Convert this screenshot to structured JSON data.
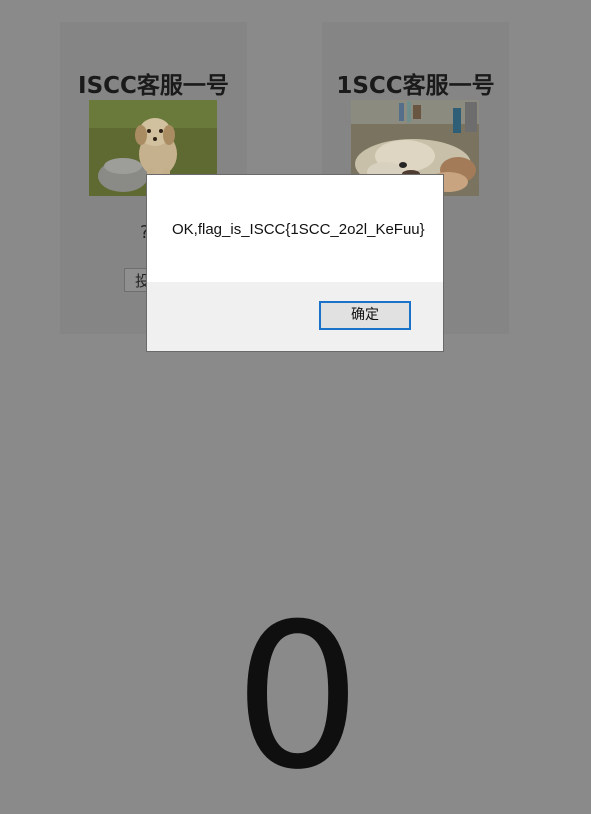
{
  "cards": [
    {
      "title": "ISCC客服一号",
      "photo_icon": "golden-retriever-puppy-photo",
      "sub_text": "?",
      "button_label": "投"
    },
    {
      "title": "1SCC客服一号",
      "photo_icon": "sleeping-dog-photo"
    }
  ],
  "counter": {
    "value": "0"
  },
  "dialog": {
    "message": "OK,flag_is_ISCC{1SCC_2o2l_KeFuu}",
    "ok_label": "确定"
  }
}
